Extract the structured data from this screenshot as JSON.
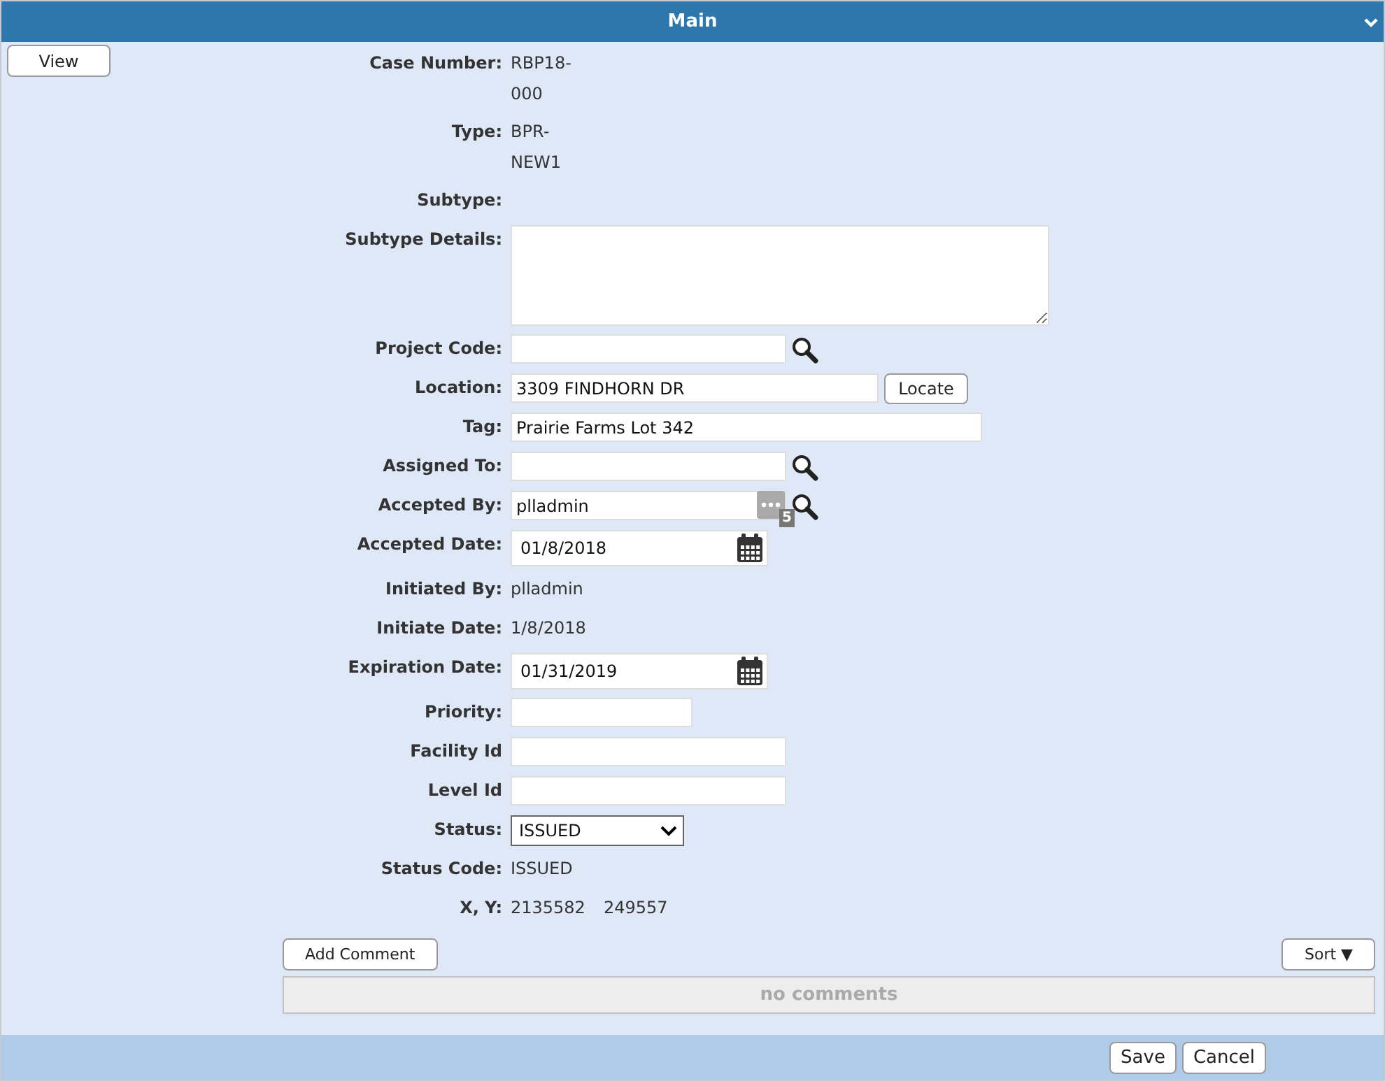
{
  "header": {
    "title": "Main"
  },
  "view_button": "View",
  "fields": [
    {
      "label": "Case Number:",
      "kind": "static",
      "value": "RBP18-000"
    },
    {
      "label": "Type:",
      "kind": "static",
      "value": "BPR-NEW1"
    },
    {
      "label": "Subtype:",
      "kind": "static"
    },
    {
      "label": "Subtype Details:",
      "kind": "memo"
    },
    {
      "label": "Project Code:",
      "kind": "lookup"
    },
    {
      "label": "Location:",
      "kind": "address",
      "value": "3309 FINDHORN DR",
      "button": "Locate"
    },
    {
      "label": "Tag:",
      "kind": "wide",
      "value": "Prairie Farms Lot 342"
    },
    {
      "label": "Assigned To:",
      "kind": "lookup"
    },
    {
      "label": "Accepted By:",
      "kind": "multi",
      "value": "plladmin",
      "count": "5"
    },
    {
      "label": "Accepted Date:",
      "kind": "date",
      "value": "01/8/2018"
    },
    {
      "label": "Initiated By:",
      "kind": "static",
      "value": "plladmin"
    },
    {
      "label": "Initiate Date:",
      "kind": "static",
      "value": "1/8/2018"
    },
    {
      "label": "Expiration Date:",
      "kind": "date",
      "value": "01/31/2019"
    },
    {
      "label": "Priority:",
      "kind": "short"
    },
    {
      "label": "Facility Id",
      "kind": "plain"
    },
    {
      "label": "Level Id",
      "kind": "plain"
    },
    {
      "label": "Status:",
      "kind": "select",
      "value": "ISSUED"
    },
    {
      "label": "Status Code:",
      "kind": "static",
      "value": "ISSUED"
    },
    {
      "label": "X, Y:",
      "kind": "coords",
      "values": [
        "2135582",
        "249557"
      ]
    }
  ],
  "comments": {
    "add_button": "Add Comment",
    "sort_button": "Sort ▼",
    "empty_text": "no comments"
  },
  "footer": {
    "buttons": [
      "Save",
      "Cancel"
    ]
  }
}
